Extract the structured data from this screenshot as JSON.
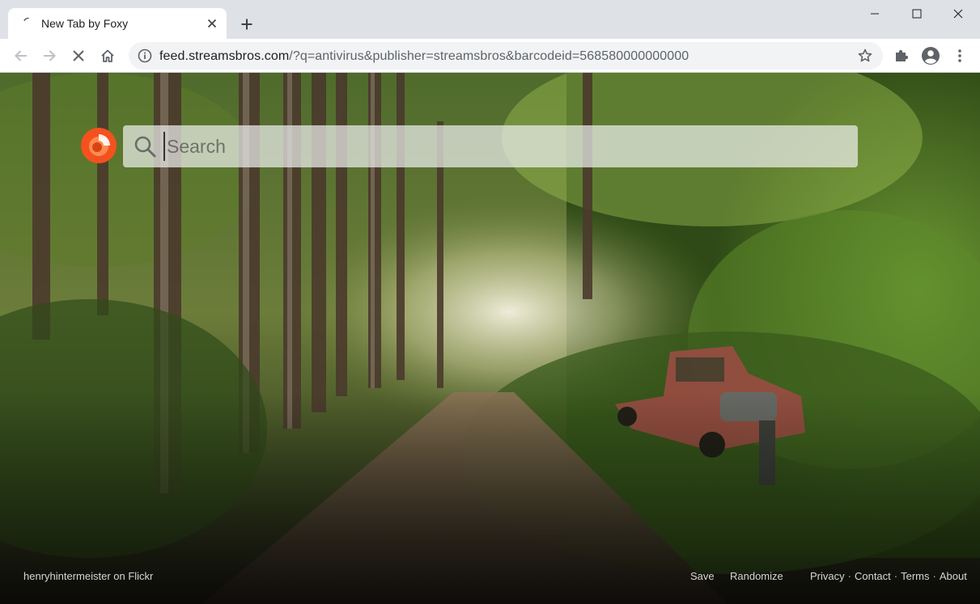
{
  "tab": {
    "title": "New Tab by Foxy",
    "close_glyph": "✕"
  },
  "address_bar": {
    "host": "feed.streamsbros.com",
    "path": "/?q=antivirus&publisher=streamsbros&barcodeid=568580000000000"
  },
  "search": {
    "placeholder": "Search"
  },
  "footer": {
    "credit": "henryhintermeister on Flickr",
    "save": "Save",
    "randomize": "Randomize",
    "privacy": "Privacy",
    "contact": "Contact",
    "terms": "Terms",
    "about": "About",
    "separator": "·"
  },
  "colors": {
    "logo_orange": "#f4511e",
    "tab_bg": "#ffffff",
    "strip_bg": "#dee1e6"
  },
  "icons": [
    "loading-spinner-icon",
    "close-icon",
    "plus-icon",
    "minimize-icon",
    "maximize-icon",
    "window-close-icon",
    "back-arrow-icon",
    "forward-arrow-icon",
    "stop-icon",
    "home-icon",
    "info-icon",
    "star-icon",
    "puzzle-icon",
    "profile-icon",
    "kebab-menu-icon",
    "foxy-logo-icon",
    "search-icon"
  ]
}
